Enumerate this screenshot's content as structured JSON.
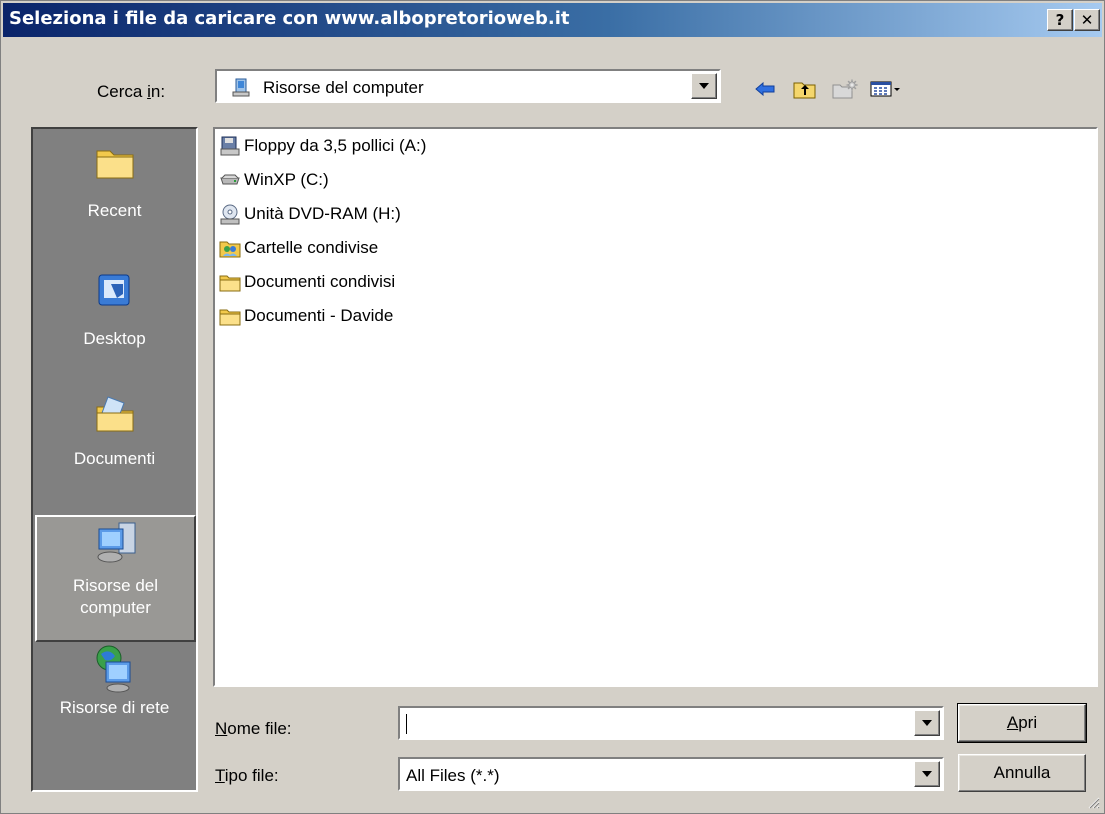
{
  "window": {
    "title": "Seleziona i file da caricare con www.albopretorioweb.it",
    "help_glyph": "?",
    "close_glyph": "✕"
  },
  "lookin": {
    "label_prefix": "Cerca ",
    "label_underline": "i",
    "label_suffix": "n:",
    "value": "Risorse del computer"
  },
  "places": [
    {
      "label": "Recent"
    },
    {
      "label": "Desktop"
    },
    {
      "label": "Documenti"
    },
    {
      "label": "Risorse del computer",
      "selected": true
    },
    {
      "label": "Risorse di rete"
    }
  ],
  "files": [
    {
      "name": "Floppy da 3,5 pollici (A:)",
      "icon": "floppy-drive-icon"
    },
    {
      "name": "WinXP (C:)",
      "icon": "hard-disk-icon"
    },
    {
      "name": "Unità DVD-RAM (H:)",
      "icon": "dvd-drive-icon"
    },
    {
      "name": "Cartelle condivise",
      "icon": "shared-folders-icon"
    },
    {
      "name": "Documenti condivisi",
      "icon": "folder-icon"
    },
    {
      "name": "Documenti - Davide",
      "icon": "folder-icon"
    }
  ],
  "filename": {
    "label_underline": "N",
    "label_rest": "ome file:",
    "value": ""
  },
  "filetype": {
    "label_underline": "T",
    "label_rest": "ipo file:",
    "value": "All Files (*.*)"
  },
  "buttons": {
    "open_underline": "A",
    "open_rest": "pri",
    "cancel": "Annulla"
  },
  "colors": {
    "face": "#d4d0c8",
    "title_start": "#0a246a",
    "title_end": "#a6caf0",
    "places_bg": "#808080"
  }
}
